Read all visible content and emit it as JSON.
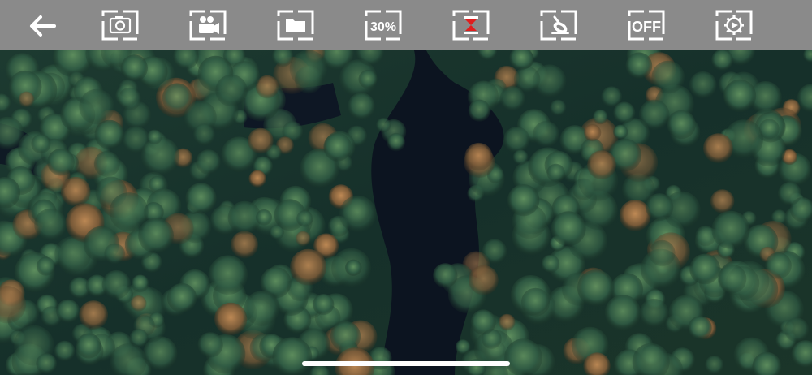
{
  "toolbar": {
    "background": "#8a8a8a",
    "buttons": [
      {
        "name": "back-button",
        "icon": "arrow-left-icon"
      },
      {
        "name": "photo-button",
        "icon": "camera-icon"
      },
      {
        "name": "video-button",
        "icon": "video-camera-icon"
      },
      {
        "name": "gallery-button",
        "icon": "folder-icon"
      },
      {
        "name": "speed-button",
        "icon": "percentage-icon",
        "label": "30%"
      },
      {
        "name": "hourglass-button",
        "icon": "hourglass-icon",
        "accent": "#e01e1e"
      },
      {
        "name": "gimbal-button",
        "icon": "gimbal-icon"
      },
      {
        "name": "headless-toggle",
        "icon": "off-icon",
        "label": "OFF"
      },
      {
        "name": "settings-button",
        "icon": "gear-icon"
      }
    ]
  },
  "feed": {
    "description_icon": "camera-feed-forest-river"
  }
}
